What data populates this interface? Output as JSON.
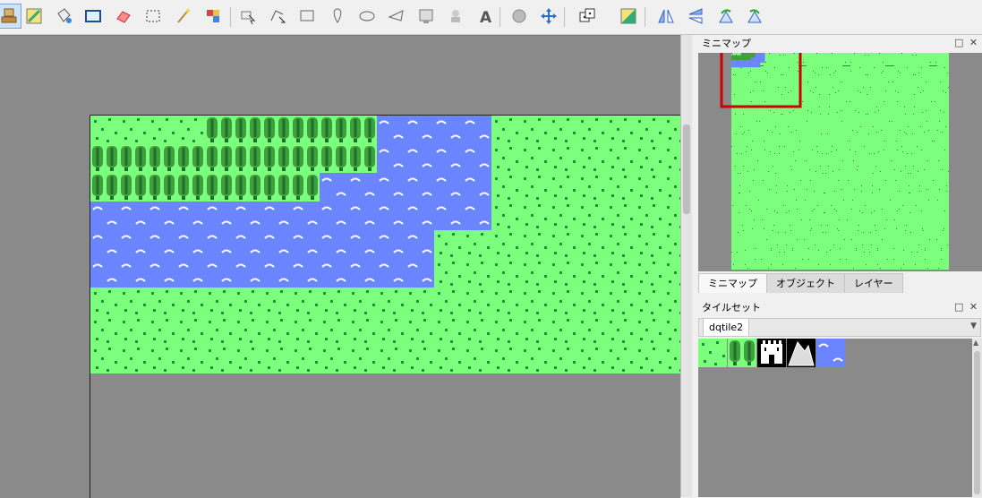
{
  "toolbar": {
    "buttons": [
      {
        "icon": "stamp-brush-icon",
        "active": true
      },
      {
        "icon": "terrain-brush-icon"
      },
      {
        "icon": "bucket-fill-icon"
      },
      {
        "icon": "shape-fill-icon"
      },
      {
        "icon": "eraser-icon"
      },
      {
        "icon": "rect-select-icon"
      },
      {
        "icon": "magic-wand-icon"
      },
      {
        "icon": "select-same-tile-icon"
      },
      {
        "icon": "select-objects-icon"
      },
      {
        "icon": "edit-polygons-icon"
      },
      {
        "icon": "insert-rectangle-icon"
      },
      {
        "icon": "insert-point-icon"
      },
      {
        "icon": "insert-ellipse-icon"
      },
      {
        "icon": "insert-polygon-icon"
      },
      {
        "icon": "insert-tile-icon"
      },
      {
        "icon": "insert-template-icon"
      },
      {
        "icon": "insert-text-icon"
      },
      {
        "icon": "world-tool-icon"
      },
      {
        "icon": "move-icon"
      },
      {
        "icon": "random-mode-icon"
      },
      {
        "icon": "wang-fill-icon"
      },
      {
        "icon": "flip-horizontal-icon"
      },
      {
        "icon": "flip-vertical-icon"
      },
      {
        "icon": "rotate-left-icon"
      },
      {
        "icon": "rotate-right-icon"
      }
    ]
  },
  "minimap_dock": {
    "title": "ミニマップ",
    "float_icon": "□",
    "close_icon": "✕"
  },
  "panel_tabs": [
    "ミニマップ",
    "オブジェクト",
    "レイヤー"
  ],
  "tileset_dock": {
    "title": "タイルセット",
    "float_icon": "□",
    "close_icon": "✕",
    "tileset_name": "dqtile2"
  },
  "colors": {
    "grass": "#7cff7c",
    "grass_dot": "#1f8f3a",
    "tree": "#3f9f3f",
    "tree_dark": "#1f6f2a",
    "water": "#6b84ff",
    "wave": "#ffffff",
    "canvas_bg": "#8a8a8a",
    "viewport_rect": "#cc0000"
  },
  "map_terrain": [
    "GGGGTTTTTTWWWWGGGGGGG",
    "TTTTTTTTTTWWWWGGGGGGG",
    "TTTTTTTTWWWWWWGGGGGGG",
    "WWWWWWWWWWWWWWGGGGGGG",
    "WWWWWWWWWWWWGGGGGGGGG",
    "WWWWWWWWWWWWGGGGGGGGG",
    "GGGGGGGGGGGGGGGGGGGGG",
    "GGGGGGGGGGGGGGGGGGGGG",
    "GGGGGGGGGGGGGGGGGGGGG"
  ],
  "tileset_tiles": [
    "grass-tile",
    "tree-tile",
    "castle-tile",
    "mountain-tile",
    "water-tile"
  ]
}
